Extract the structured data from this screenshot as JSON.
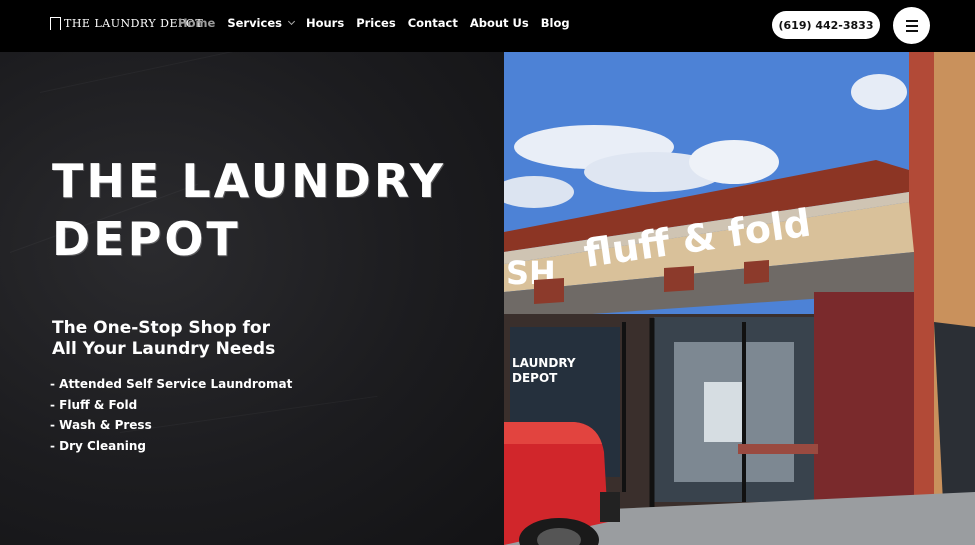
{
  "header": {
    "logo_text": "THE LAUNDRY DEPOT",
    "nav": [
      {
        "label": "Home",
        "active": true
      },
      {
        "label": "Services",
        "has_dropdown": true
      },
      {
        "label": "Hours"
      },
      {
        "label": "Prices"
      },
      {
        "label": "Contact"
      },
      {
        "label": "About Us"
      },
      {
        "label": "Blog"
      }
    ],
    "phone": "(619) 442-3833",
    "menu_icon": "hamburger-icon"
  },
  "hero": {
    "title": "THE LAUNDRY DEPOT",
    "subtitle_line1": "The One-Stop Shop for",
    "subtitle_line2": "All Your Laundry Needs",
    "services": [
      "- Attended Self Service Laundromat",
      "- Fluff & Fold",
      "- Wash & Press",
      "- Dry Cleaning"
    ],
    "photo": {
      "sign_text": "fluff & fold",
      "sign_partial": "SH",
      "window_text_1": "LAUNDRY",
      "window_text_2": "DEPOT"
    }
  },
  "colors": {
    "header_bg": "#000000",
    "chalkboard": "#1e1e21",
    "accent_inactive": "#9a9a9a",
    "sky": "#4a7fd4",
    "truck_red": "#d1262b"
  }
}
